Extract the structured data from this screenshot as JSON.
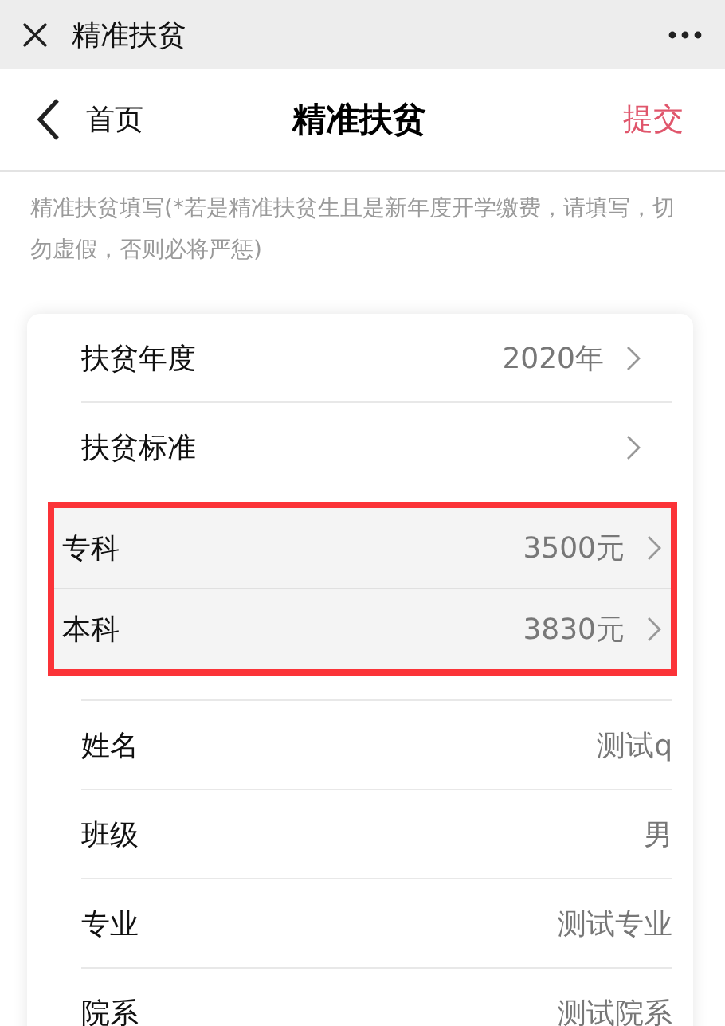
{
  "window": {
    "title": "精准扶贫"
  },
  "nav": {
    "back": "首页",
    "title": "精准扶贫",
    "action": "提交"
  },
  "hint": "精准扶贫填写(*若是精准扶贫生且是新年度开学缴费，请填写，切勿虚假，否则必将严惩)",
  "top_rows": [
    {
      "kind": "select",
      "label": "扶贫年度",
      "value": "2020年"
    },
    {
      "kind": "select",
      "label": "扶贫标准"
    }
  ],
  "options": [
    {
      "label": "专科",
      "value": "3500元"
    },
    {
      "label": "本科",
      "value": "3830元"
    }
  ],
  "rows": [
    {
      "kind": "text",
      "label": "姓名",
      "value": "测试q"
    },
    {
      "kind": "text",
      "label": "班级",
      "value": "男"
    },
    {
      "kind": "text",
      "label": "专业",
      "value": "测试专业"
    },
    {
      "kind": "text",
      "label": "院系",
      "value": "测试院系"
    }
  ]
}
